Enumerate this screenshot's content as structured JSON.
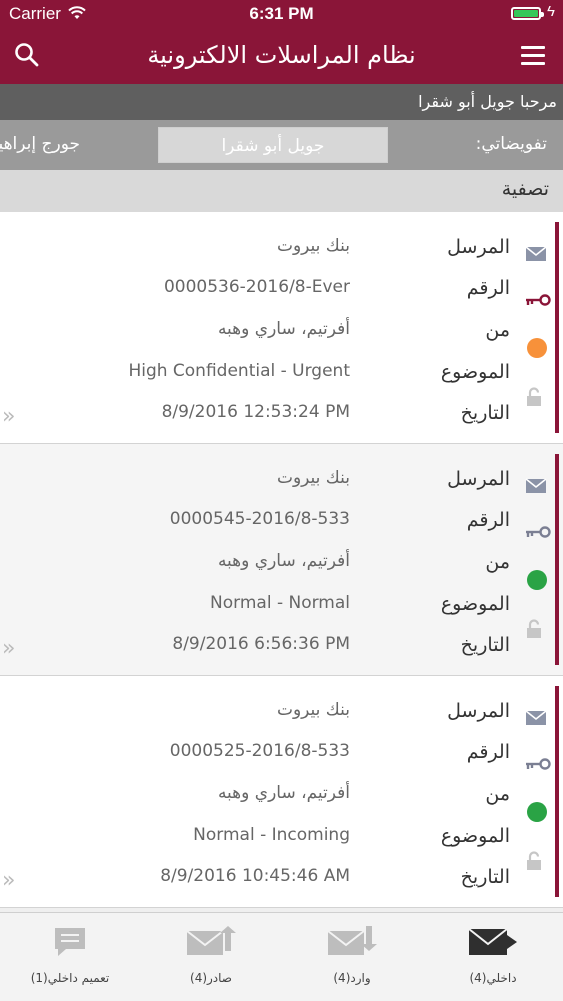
{
  "status": {
    "carrier": "Carrier",
    "time": "6:31 PM"
  },
  "header": {
    "title": "نظام المراسلات الالكترونية"
  },
  "welcome": "مرحبا جويل أبو شقرا",
  "delegations": {
    "label": "تفويضاتي:",
    "current": "جويل أبو شقرا",
    "next": "جورج إبراهيم"
  },
  "filter": "تصفية",
  "labels": {
    "sender": "المرسل",
    "number": "الرقم",
    "from": "من",
    "subject": "الموضوع",
    "date": "التاريخ"
  },
  "items": [
    {
      "sender": "بنك بيروت",
      "number": "0000536-2016/8-Ever",
      "from": "أفرتيم، ساري وهبه",
      "subject": "High Confidential - Urgent",
      "date": "8/9/2016 12:53:24 PM",
      "priority_color": "#f7913a",
      "key_color": "#8a1538"
    },
    {
      "sender": "بنك بيروت",
      "number": "0000545-2016/8-533",
      "from": "أفرتيم، ساري وهبه",
      "subject": "Normal - Normal",
      "date": "8/9/2016 6:56:36 PM",
      "priority_color": "#2aa345",
      "key_color": "#7b7f93"
    },
    {
      "sender": "بنك بيروت",
      "number": "0000525-2016/8-533",
      "from": "أفرتيم، ساري وهبه",
      "subject": "Normal - Incoming",
      "date": "8/9/2016 10:45:46 AM",
      "priority_color": "#2aa345",
      "key_color": "#7b7f93"
    }
  ],
  "tabs": {
    "internal": "داخلي(4)",
    "incoming": "وارد(4)",
    "outgoing": "صادر(4)",
    "circular": "تعميم داخلي(1)"
  },
  "colors": {
    "brand": "#8a1538"
  }
}
